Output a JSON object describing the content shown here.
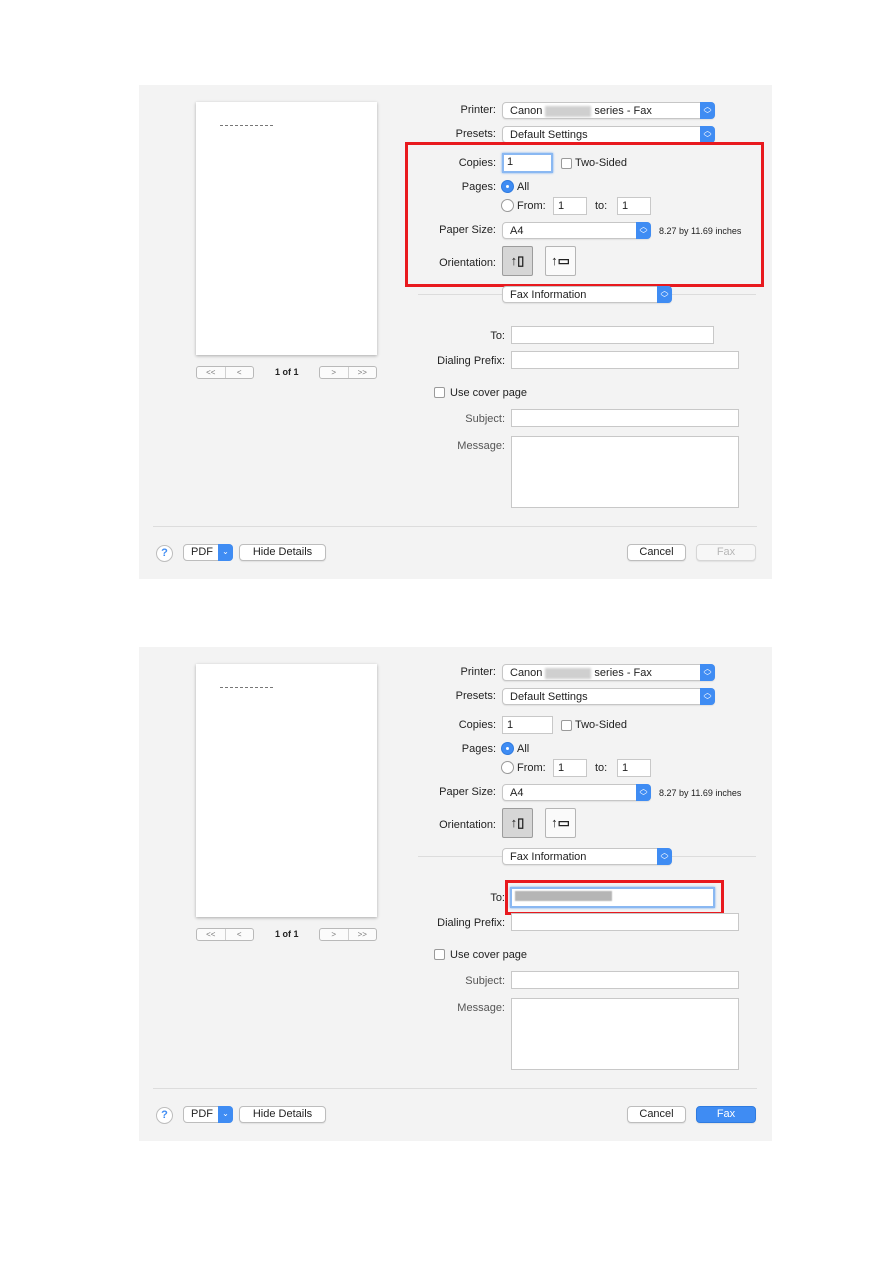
{
  "dialogs": [
    {
      "preview": {
        "page_counter": "1 of 1",
        "nav_first": "<<",
        "nav_prev": "<",
        "nav_next": ">",
        "nav_last": ">>"
      },
      "printer": {
        "label": "Printer:",
        "value_prefix": "Canon",
        "value_suffix": "series - Fax",
        "redacted": true
      },
      "presets": {
        "label": "Presets:",
        "value": "Default Settings"
      },
      "copies": {
        "label": "Copies:",
        "value": "1",
        "focused": true
      },
      "two_sided": {
        "label": "Two-Sided",
        "checked": false
      },
      "pages": {
        "label": "Pages:",
        "all_label": "All",
        "all_selected": true,
        "from_label": "From:",
        "from_value": "1",
        "to_label": "to:",
        "to_value": "1"
      },
      "paper_size": {
        "label": "Paper Size:",
        "value": "A4",
        "dimensions": "8.27 by 11.69 inches"
      },
      "orientation": {
        "label": "Orientation:",
        "options": [
          "portrait-icon",
          "landscape-icon"
        ],
        "selected": "portrait"
      },
      "section_select": {
        "value": "Fax Information"
      },
      "to": {
        "label": "To:",
        "value": "",
        "focused": false
      },
      "dialing_prefix": {
        "label": "Dialing Prefix:",
        "value": ""
      },
      "use_cover_page": {
        "label": "Use cover page",
        "checked": false
      },
      "subject": {
        "label": "Subject:",
        "value": ""
      },
      "message": {
        "label": "Message:",
        "value": ""
      },
      "footer": {
        "help": "?",
        "pdf": "PDF",
        "hide_details": "Hide Details",
        "cancel": "Cancel",
        "fax": "Fax",
        "fax_enabled": false
      },
      "highlight": "print-settings-group"
    },
    {
      "preview": {
        "page_counter": "1 of 1",
        "nav_first": "<<",
        "nav_prev": "<",
        "nav_next": ">",
        "nav_last": ">>"
      },
      "printer": {
        "label": "Printer:",
        "value_prefix": "Canon",
        "value_suffix": "series - Fax",
        "redacted": true
      },
      "presets": {
        "label": "Presets:",
        "value": "Default Settings"
      },
      "copies": {
        "label": "Copies:",
        "value": "1",
        "focused": false
      },
      "two_sided": {
        "label": "Two-Sided",
        "checked": false
      },
      "pages": {
        "label": "Pages:",
        "all_label": "All",
        "all_selected": true,
        "from_label": "From:",
        "from_value": "1",
        "to_label": "to:",
        "to_value": "1"
      },
      "paper_size": {
        "label": "Paper Size:",
        "value": "A4",
        "dimensions": "8.27 by 11.69 inches"
      },
      "orientation": {
        "label": "Orientation:",
        "options": [
          "portrait-icon",
          "landscape-icon"
        ],
        "selected": "portrait"
      },
      "section_select": {
        "value": "Fax Information"
      },
      "to": {
        "label": "To:",
        "value": "(redacted fax number)",
        "focused": true
      },
      "dialing_prefix": {
        "label": "Dialing Prefix:",
        "value": ""
      },
      "use_cover_page": {
        "label": "Use cover page",
        "checked": false
      },
      "subject": {
        "label": "Subject:",
        "value": ""
      },
      "message": {
        "label": "Message:",
        "value": ""
      },
      "footer": {
        "help": "?",
        "pdf": "PDF",
        "hide_details": "Hide Details",
        "cancel": "Cancel",
        "fax": "Fax",
        "fax_enabled": true
      },
      "highlight": "to-field"
    }
  ],
  "colors": {
    "accent": "#3f8cf3",
    "highlight_red": "#e8191e",
    "dialog_bg": "#f3f3f3"
  }
}
